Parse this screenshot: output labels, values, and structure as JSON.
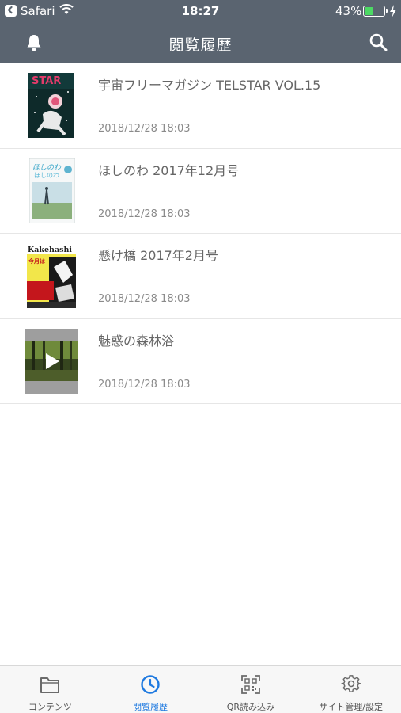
{
  "status_bar": {
    "app": "Safari",
    "time": "18:27",
    "battery": "43%"
  },
  "nav": {
    "title": "閲覧履歴"
  },
  "history": [
    {
      "title": "宇宙フリーマガジン TELSTAR VOL.15",
      "date": "2018/12/28 18:03",
      "thumb_icon": "telstar-cover"
    },
    {
      "title": "ほしのわ 2017年12月号",
      "date": "2018/12/28 18:03",
      "thumb_icon": "hoshinowa-cover"
    },
    {
      "title": "懸け橋 2017年2月号",
      "date": "2018/12/28 18:03",
      "thumb_icon": "kakehashi-cover"
    },
    {
      "title": "魅惑の森林浴",
      "date": "2018/12/28 18:03",
      "thumb_icon": "forest-video-thumbnail"
    }
  ],
  "tabs": [
    {
      "label": "コンテンツ",
      "icon": "folder-icon",
      "active": false
    },
    {
      "label": "閲覧履歴",
      "icon": "clock-icon",
      "active": true
    },
    {
      "label": "QR読み込み",
      "icon": "qr-code-icon",
      "active": false
    },
    {
      "label": "サイト管理/設定",
      "icon": "gear-icon",
      "active": false
    }
  ],
  "colors": {
    "header": "#5a6470",
    "active_tab": "#1f7ae0",
    "battery": "#4cd964"
  }
}
